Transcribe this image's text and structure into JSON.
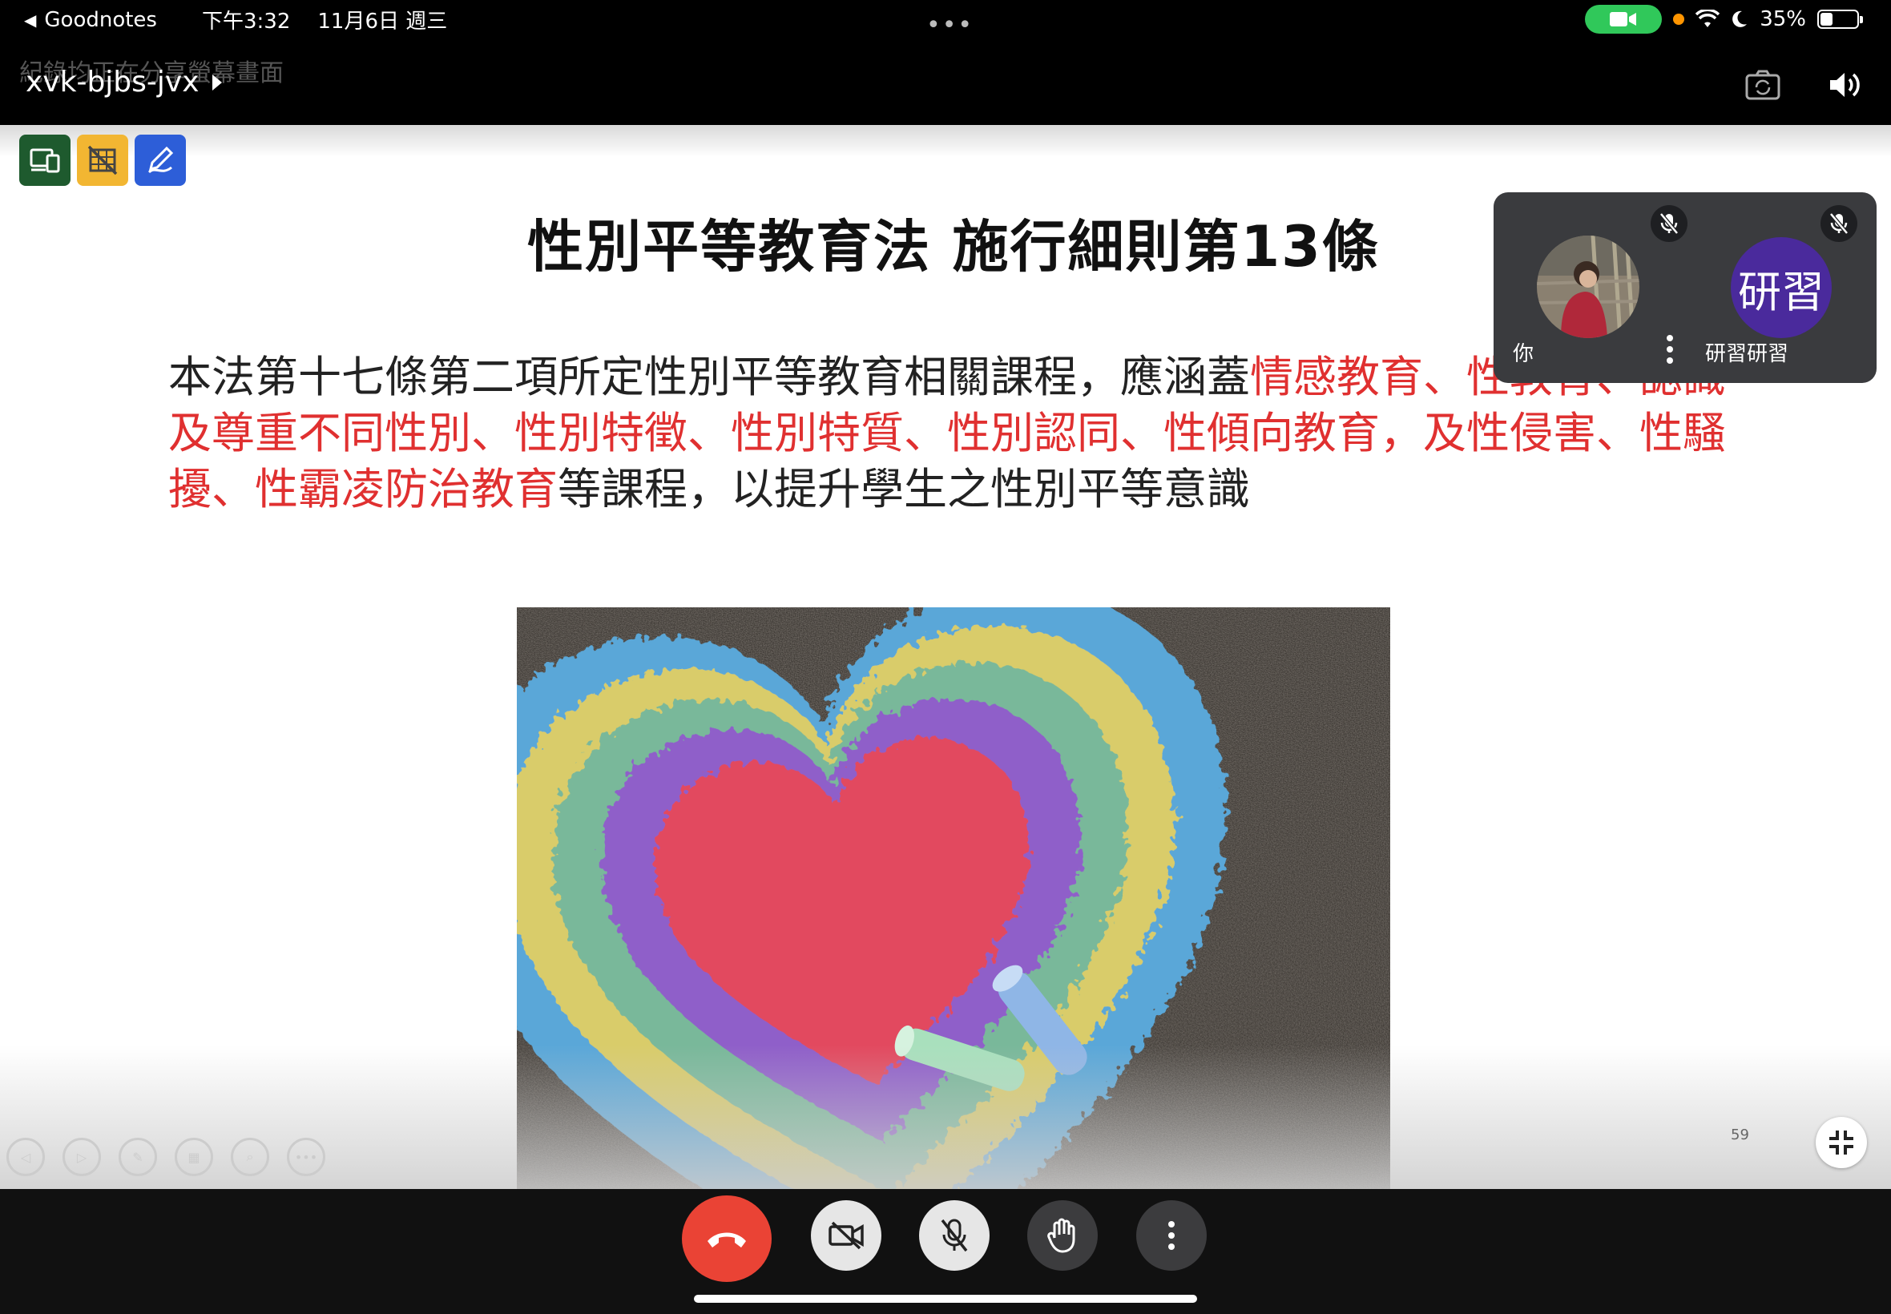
{
  "status_bar": {
    "back_app": "Goodnotes",
    "time": "下午3:32",
    "date": "11月6日 週三",
    "battery_text": "35%",
    "battery_level": 0.35
  },
  "header": {
    "recording_notice": "紀錄均正在分享螢幕畫面",
    "meeting_code": "xvk-bjbs-jvx"
  },
  "slide": {
    "title": "性別平等教育法 施行細則第13條",
    "body": [
      {
        "text": "本法第十七條第二項所定性別平等教育相關課程，應涵蓋",
        "color": "normal"
      },
      {
        "text": "情感教育、性教育、認識及尊重不同性別、性別特徵、性別特質、性別認同、性傾向教育，及性侵害、性騷擾、性霸凌防治教育",
        "color": "red"
      },
      {
        "text": "等課程，以提升學生之性別平等意識",
        "color": "normal"
      }
    ],
    "page_number": "59"
  },
  "participants": {
    "self_label": "你",
    "other_label": "研習研習",
    "other_initials": "研習"
  },
  "colors": {
    "accent_red": "#e03030",
    "end_call": "#ea4335",
    "camera_pill": "#30c85a",
    "avatar": "#4a2a9c"
  }
}
